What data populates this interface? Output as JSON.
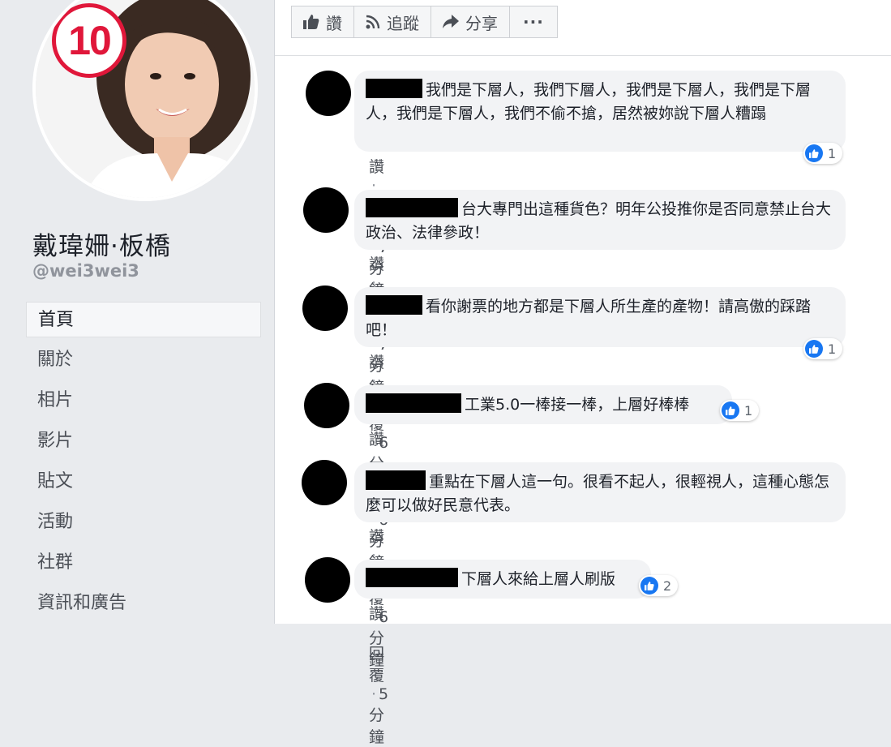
{
  "sidebar": {
    "badge_number": "10",
    "page_name": "戴瑋姍·板橋",
    "handle": "@wei3wei3",
    "nav": [
      "首頁",
      "關於",
      "相片",
      "影片",
      "貼文",
      "活動",
      "社群",
      "資訊和廣告"
    ]
  },
  "actions": {
    "like": "讚",
    "follow": "追蹤",
    "share": "分享",
    "more": "···"
  },
  "comments": [
    {
      "text": "我們是下層人，我們下層人，我們是下層人，我們是下層人，我們是下層人，我們不偷不搶，居然被妳說下層人糟蹋",
      "likes": "1",
      "like_label": "讚",
      "reply_label": "回覆",
      "time": "7分鐘"
    },
    {
      "text": "台大專門出這種貨色？明年公投推你是否同意禁止台大政治、法律參政！",
      "likes": "",
      "like_label": "讚",
      "reply_label": "回覆",
      "time": "7分鐘"
    },
    {
      "text": "看你謝票的地方都是下層人所生產的產物！請高傲的踩踏吧！",
      "likes": "1",
      "like_label": "讚",
      "reply_label": "回覆",
      "time": "6分鐘"
    },
    {
      "text": "工業5.0一棒接一棒，上層好棒棒",
      "likes": "1",
      "like_label": "讚",
      "reply_label": "回覆",
      "time": "6分鐘"
    },
    {
      "text": "重點在下層人這一句。很看不起人，很輕視人，這種心態怎麼可以做好民意代表。",
      "likes": "",
      "like_label": "讚",
      "reply_label": "回覆",
      "time": "6分鐘"
    },
    {
      "text": "下層人來給上層人刷版",
      "likes": "2",
      "like_label": "讚",
      "reply_label": "回覆",
      "time": "5分鐘"
    }
  ],
  "colors": {
    "like_blue": "#1877f2",
    "sidebar_bg": "#e9ebee",
    "bubble_bg": "#f2f3f5"
  }
}
